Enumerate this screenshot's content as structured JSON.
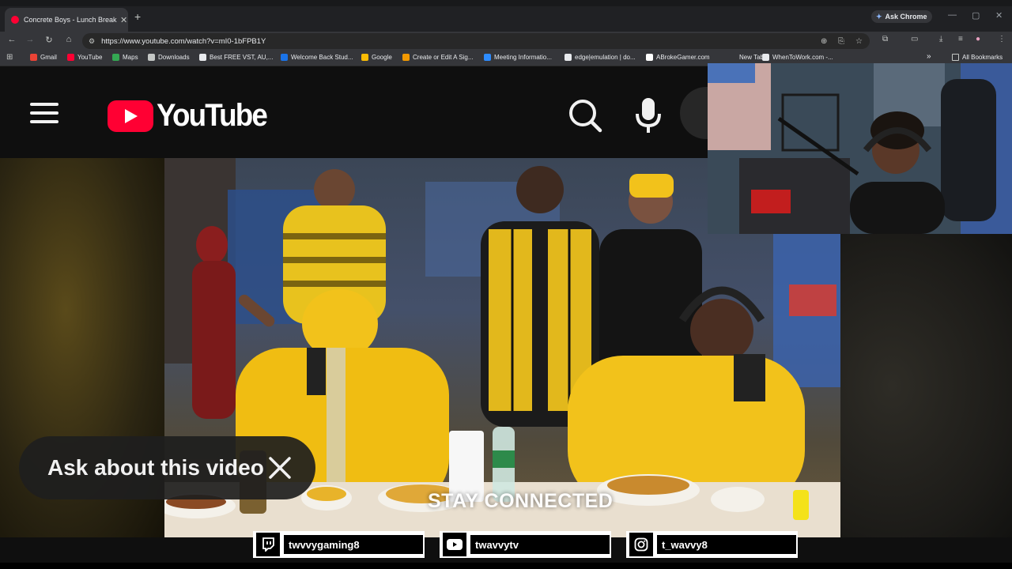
{
  "browser": {
    "tab_title": "Concrete Boys - Lunch Break Fr",
    "new_tab_glyph": "+",
    "ask_chrome": "Ask Chrome",
    "url": "https://www.youtube.com/watch?v=mI0-1bFPB1Y",
    "bookmarks": [
      {
        "label": "Gmail",
        "color": "#ea4335"
      },
      {
        "label": "YouTube",
        "color": "#ff0033"
      },
      {
        "label": "Maps",
        "color": "#34a853"
      },
      {
        "label": "Downloads",
        "color": "#c4c7c5"
      },
      {
        "label": "Best FREE VST, AU,...",
        "color": "#e8eaed"
      },
      {
        "label": "Welcome Back Stud...",
        "color": "#1a73e8"
      },
      {
        "label": "Google",
        "color": "#fbbc05"
      },
      {
        "label": "Create or Edit A Sig...",
        "color": "#f29900"
      },
      {
        "label": "Meeting Informatio...",
        "color": "#2d8cff"
      },
      {
        "label": "edge|emulation | do...",
        "color": "#e8eaed"
      },
      {
        "label": "ABrokeGamer.com",
        "color": "#ffffff"
      },
      {
        "label": "New Tab",
        "color": "#35363a"
      },
      {
        "label": "WhenToWork.com -...",
        "color": "#e8eaed"
      }
    ],
    "all_bookmarks": "All Bookmarks",
    "more_bookmarks": "»"
  },
  "youtube": {
    "logo_text": "YouTube",
    "ask_pill": "Ask about this video"
  },
  "video": {
    "overlay_text": "STAY CONNECTED"
  },
  "socials": [
    {
      "icon": "twitch-icon",
      "handle": "twvvygaming8"
    },
    {
      "icon": "youtube-icon",
      "handle": "twavvytv"
    },
    {
      "icon": "instagram-icon",
      "handle": "t_wavvy8"
    }
  ],
  "colors": {
    "youtube_red": "#ff0033",
    "chrome_dark": "#35363a",
    "jacket_yellow": "#f2c21b"
  }
}
